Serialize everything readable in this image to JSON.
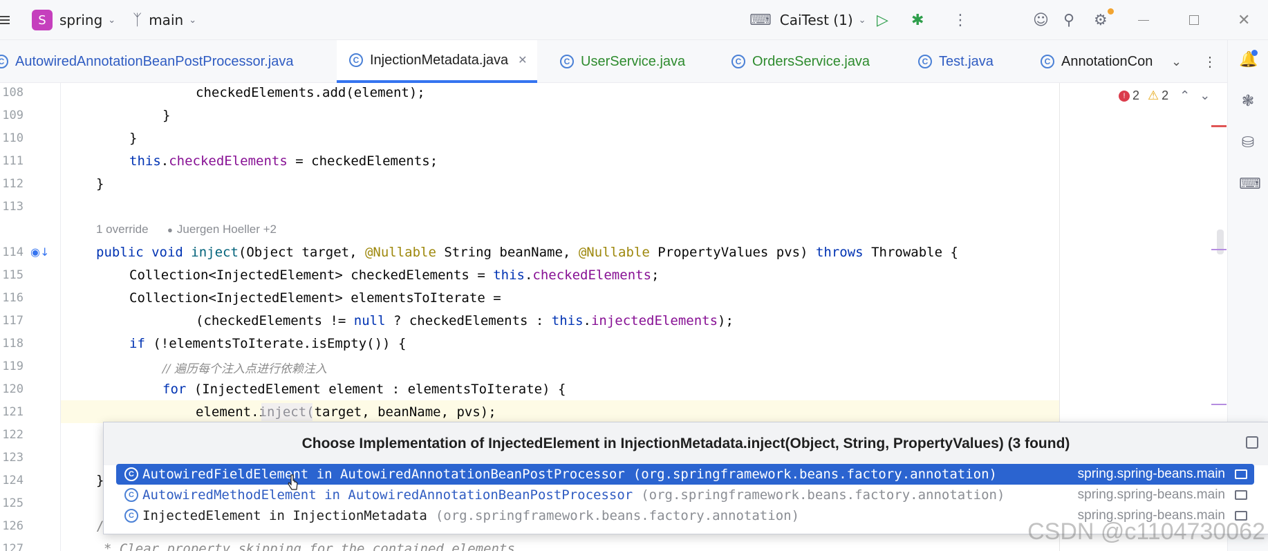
{
  "titlebar": {
    "project_letter": "S",
    "project_name": "spring",
    "branch": "main",
    "run_config": "CaiTest (1)"
  },
  "tabs": [
    {
      "label": "AutowiredAnnotationBeanPostProcessor.java",
      "color": "#2f5cc2"
    },
    {
      "label": "InjectionMetadata.java",
      "color": "#1f1f1f",
      "active": true
    },
    {
      "label": "UserService.java",
      "color": "#2e8b2e"
    },
    {
      "label": "OrdersService.java",
      "color": "#2e8b2e"
    },
    {
      "label": "Test.java",
      "color": "#2f5cc2"
    },
    {
      "label": "AnnotationCon",
      "color": "#1f1f1f"
    }
  ],
  "inspections": {
    "errors": "2",
    "warnings": "2"
  },
  "editor": {
    "line_numbers": [
      "108",
      "109",
      "110",
      "111",
      "112",
      "113",
      "114",
      "115",
      "116",
      "117",
      "118",
      "119",
      "120",
      "121",
      "122",
      "123",
      "124",
      "125",
      "126",
      "127"
    ],
    "hint_override": "1 override",
    "hint_author": "Juergen Hoeller +2",
    "code": {
      "l108": "checkedElements.add(element);",
      "l109": "}",
      "l110": "}",
      "l111_a": "this",
      "l111_b": ".",
      "l111_c": "checkedElements",
      "l111_d": " = checkedElements;",
      "l112": "}",
      "l114_kw": "public void ",
      "l114_fn": "inject",
      "l114_a": "(Object target, ",
      "l114_ann1": "@Nullable",
      "l114_b": " String beanName, ",
      "l114_ann2": "@Nullable",
      "l114_c": " PropertyValues pvs) ",
      "l114_kw2": "throws",
      "l114_d": " Throwable {",
      "l115_a": "Collection<InjectedElement> checkedElements = ",
      "l115_kw": "this",
      "l115_b": ".",
      "l115_fld": "checkedElements",
      "l115_c": ";",
      "l116": "Collection<InjectedElement> elementsToIterate =",
      "l117_a": "(checkedElements != ",
      "l117_kw": "null",
      "l117_b": " ? checkedElements : ",
      "l117_kw2": "this",
      "l117_c": ".",
      "l117_fld": "injectedElements",
      "l117_d": ");",
      "l118_kw": "if",
      "l118_a": " (!elementsToIterate.isEmpty()) {",
      "l119": "// 遍历每个注入点进行依赖注入",
      "l120_kw": "for",
      "l120_a": " (InjectedElement element : elementsToIterate) {",
      "l121": "element.inject(target, beanName, pvs);",
      "l124": "}",
      "l126": "/",
      "l127": "* Clear property skipping for the contained elements."
    }
  },
  "popup": {
    "title": "Choose Implementation of InjectedElement in InjectionMetadata.inject(Object, String, PropertyValues) (3 found)",
    "rows": [
      {
        "name": "AutowiredFieldElement in AutowiredAnnotationBeanPostProcessor",
        "package": "(org.springframework.beans.factory.annotation)",
        "module": "spring.spring-beans.main"
      },
      {
        "name": "AutowiredMethodElement in AutowiredAnnotationBeanPostProcessor",
        "package": "(org.springframework.beans.factory.annotation)",
        "module": "spring.spring-beans.main"
      },
      {
        "name": "InjectedElement in InjectionMetadata",
        "package": "(org.springframework.beans.factory.annotation)",
        "module": "spring.spring-beans.main"
      }
    ]
  },
  "watermark": "CSDN @c1104730062",
  "colors": {
    "accent": "#3574f0",
    "selection": "#2b64d0",
    "keyword": "#0033b3",
    "field": "#871094",
    "annotation": "#9e880d"
  }
}
